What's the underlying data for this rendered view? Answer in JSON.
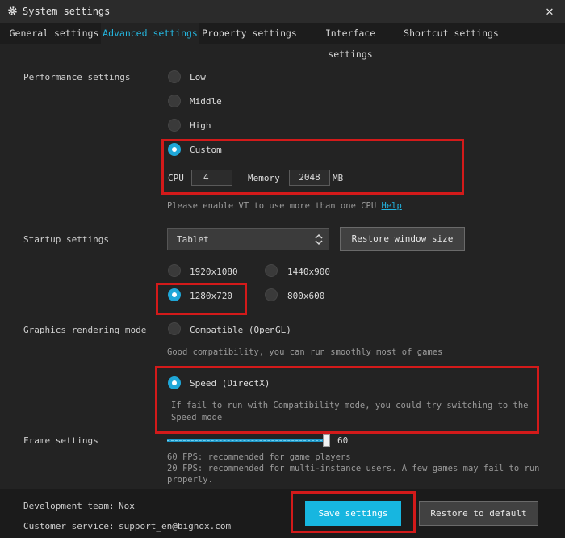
{
  "window": {
    "title": "System settings",
    "close_icon": "close-icon",
    "gear_icon": "gear-icon"
  },
  "tabs": [
    {
      "label": "General settings",
      "active": false
    },
    {
      "label": "Advanced settings",
      "active": true
    },
    {
      "label": "Property settings",
      "active": false
    },
    {
      "label": "Interface settings",
      "active": false
    },
    {
      "label": "Shortcut settings",
      "active": false
    }
  ],
  "performance": {
    "label": "Performance settings",
    "options": [
      "Low",
      "Middle",
      "High",
      "Custom"
    ],
    "selected": "Custom",
    "cpu_label": "CPU",
    "cpu_value": "4",
    "memory_label": "Memory",
    "memory_value": "2048",
    "memory_unit": "MB",
    "hint": "Please enable VT to use more than one CPU",
    "help_link": "Help"
  },
  "startup": {
    "label": "Startup settings",
    "mode_value": "Tablet",
    "restore_window_button": "Restore window size",
    "resolutions": [
      "1920x1080",
      "1440x900",
      "1280x720",
      "800x600"
    ],
    "selected_resolution": "1280x720"
  },
  "graphics": {
    "label": "Graphics rendering mode",
    "compatible_label": "Compatible (OpenGL)",
    "compatible_hint": "Good compatibility, you can run smoothly most of games",
    "speed_label": "Speed (DirectX)",
    "speed_hint_line1": "If fail to run with Compatibility mode, you could try switching to the",
    "speed_hint_line2": "Speed mode",
    "selected": "Speed (DirectX)"
  },
  "frame": {
    "label": "Frame settings",
    "value": "60",
    "hint_60": "60 FPS: recommended for game players",
    "hint_20_line1": "20 FPS: recommended for multi-instance users. A few games may fail to run",
    "hint_20_line2": "properly."
  },
  "footer": {
    "dev_team_label": "Development team:",
    "dev_team_value": "Nox",
    "customer_service_label": "Customer service:",
    "customer_service_value": "support_en@bignox.com",
    "save_button": "Save settings",
    "restore_default_button": "Restore to default"
  },
  "colors": {
    "accent": "#17b6e0",
    "highlight_box": "#d31a1a",
    "background": "#232323"
  }
}
